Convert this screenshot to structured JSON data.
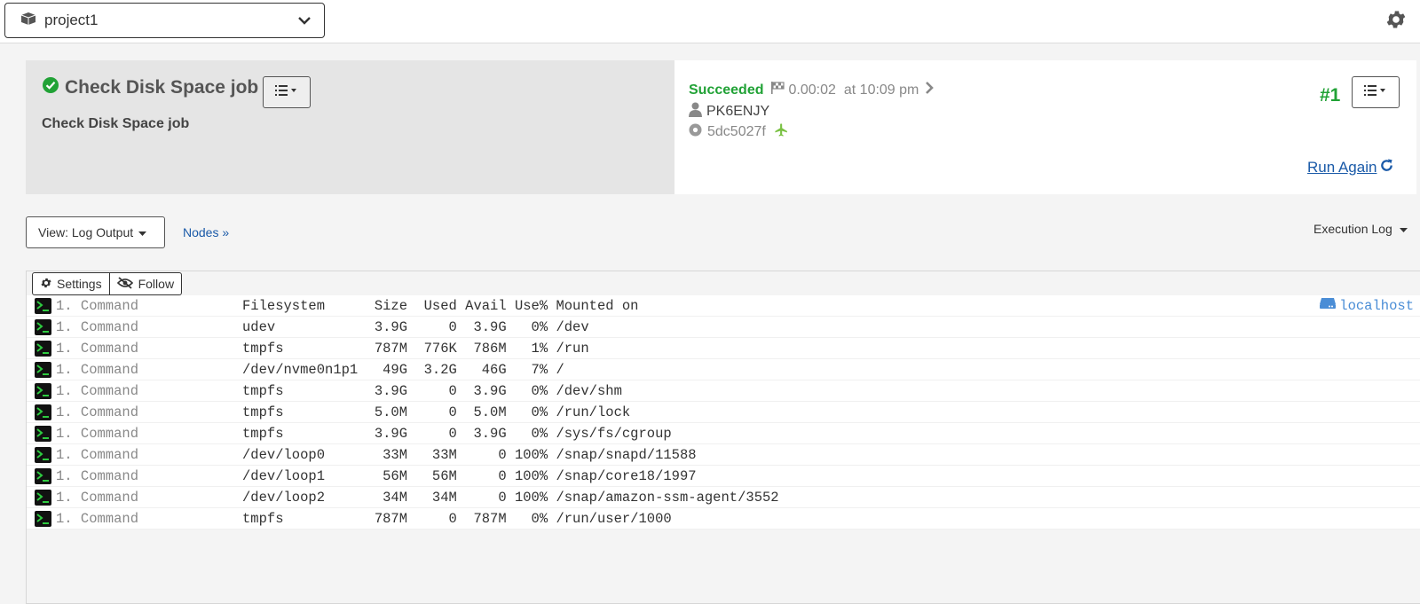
{
  "topbar": {
    "project": "project1",
    "project_icon": "cubes-icon",
    "settings_icon": "gear-icon"
  },
  "job": {
    "title": "Check Disk Space job",
    "description": "Check Disk Space job"
  },
  "execution": {
    "status": "Succeeded",
    "duration": "0.00:02",
    "time": "at 10:09 pm",
    "user": "PK6ENJY",
    "node_id": "5dc5027f",
    "number": "#1",
    "run_again": "Run Again"
  },
  "toolbar": {
    "view_label": "View: Log Output",
    "nodes_label": "Nodes »",
    "exec_log_label": "Execution Log"
  },
  "log": {
    "settings_label": "Settings",
    "follow_label": "Follow",
    "node": "localhost",
    "rows": [
      {
        "step": "1. Command",
        "text": "Filesystem      Size  Used Avail Use% Mounted on"
      },
      {
        "step": "1. Command",
        "text": "udev            3.9G     0  3.9G   0% /dev"
      },
      {
        "step": "1. Command",
        "text": "tmpfs           787M  776K  786M   1% /run"
      },
      {
        "step": "1. Command",
        "text": "/dev/nvme0n1p1   49G  3.2G   46G   7% /"
      },
      {
        "step": "1. Command",
        "text": "tmpfs           3.9G     0  3.9G   0% /dev/shm"
      },
      {
        "step": "1. Command",
        "text": "tmpfs           5.0M     0  5.0M   0% /run/lock"
      },
      {
        "step": "1. Command",
        "text": "tmpfs           3.9G     0  3.9G   0% /sys/fs/cgroup"
      },
      {
        "step": "1. Command",
        "text": "/dev/loop0       33M   33M     0 100% /snap/snapd/11588"
      },
      {
        "step": "1. Command",
        "text": "/dev/loop1       56M   56M     0 100% /snap/core18/1997"
      },
      {
        "step": "1. Command",
        "text": "/dev/loop2       34M   34M     0 100% /snap/amazon-ssm-agent/3552"
      },
      {
        "step": "1. Command",
        "text": "tmpfs           787M     0  787M   0% /run/user/1000"
      }
    ]
  },
  "colors": {
    "success": "#21a236",
    "link": "#1a5aa8",
    "node": "#4a8dd6",
    "terminal_bg": "#111111",
    "terminal_prompt": "#2ecc40"
  }
}
